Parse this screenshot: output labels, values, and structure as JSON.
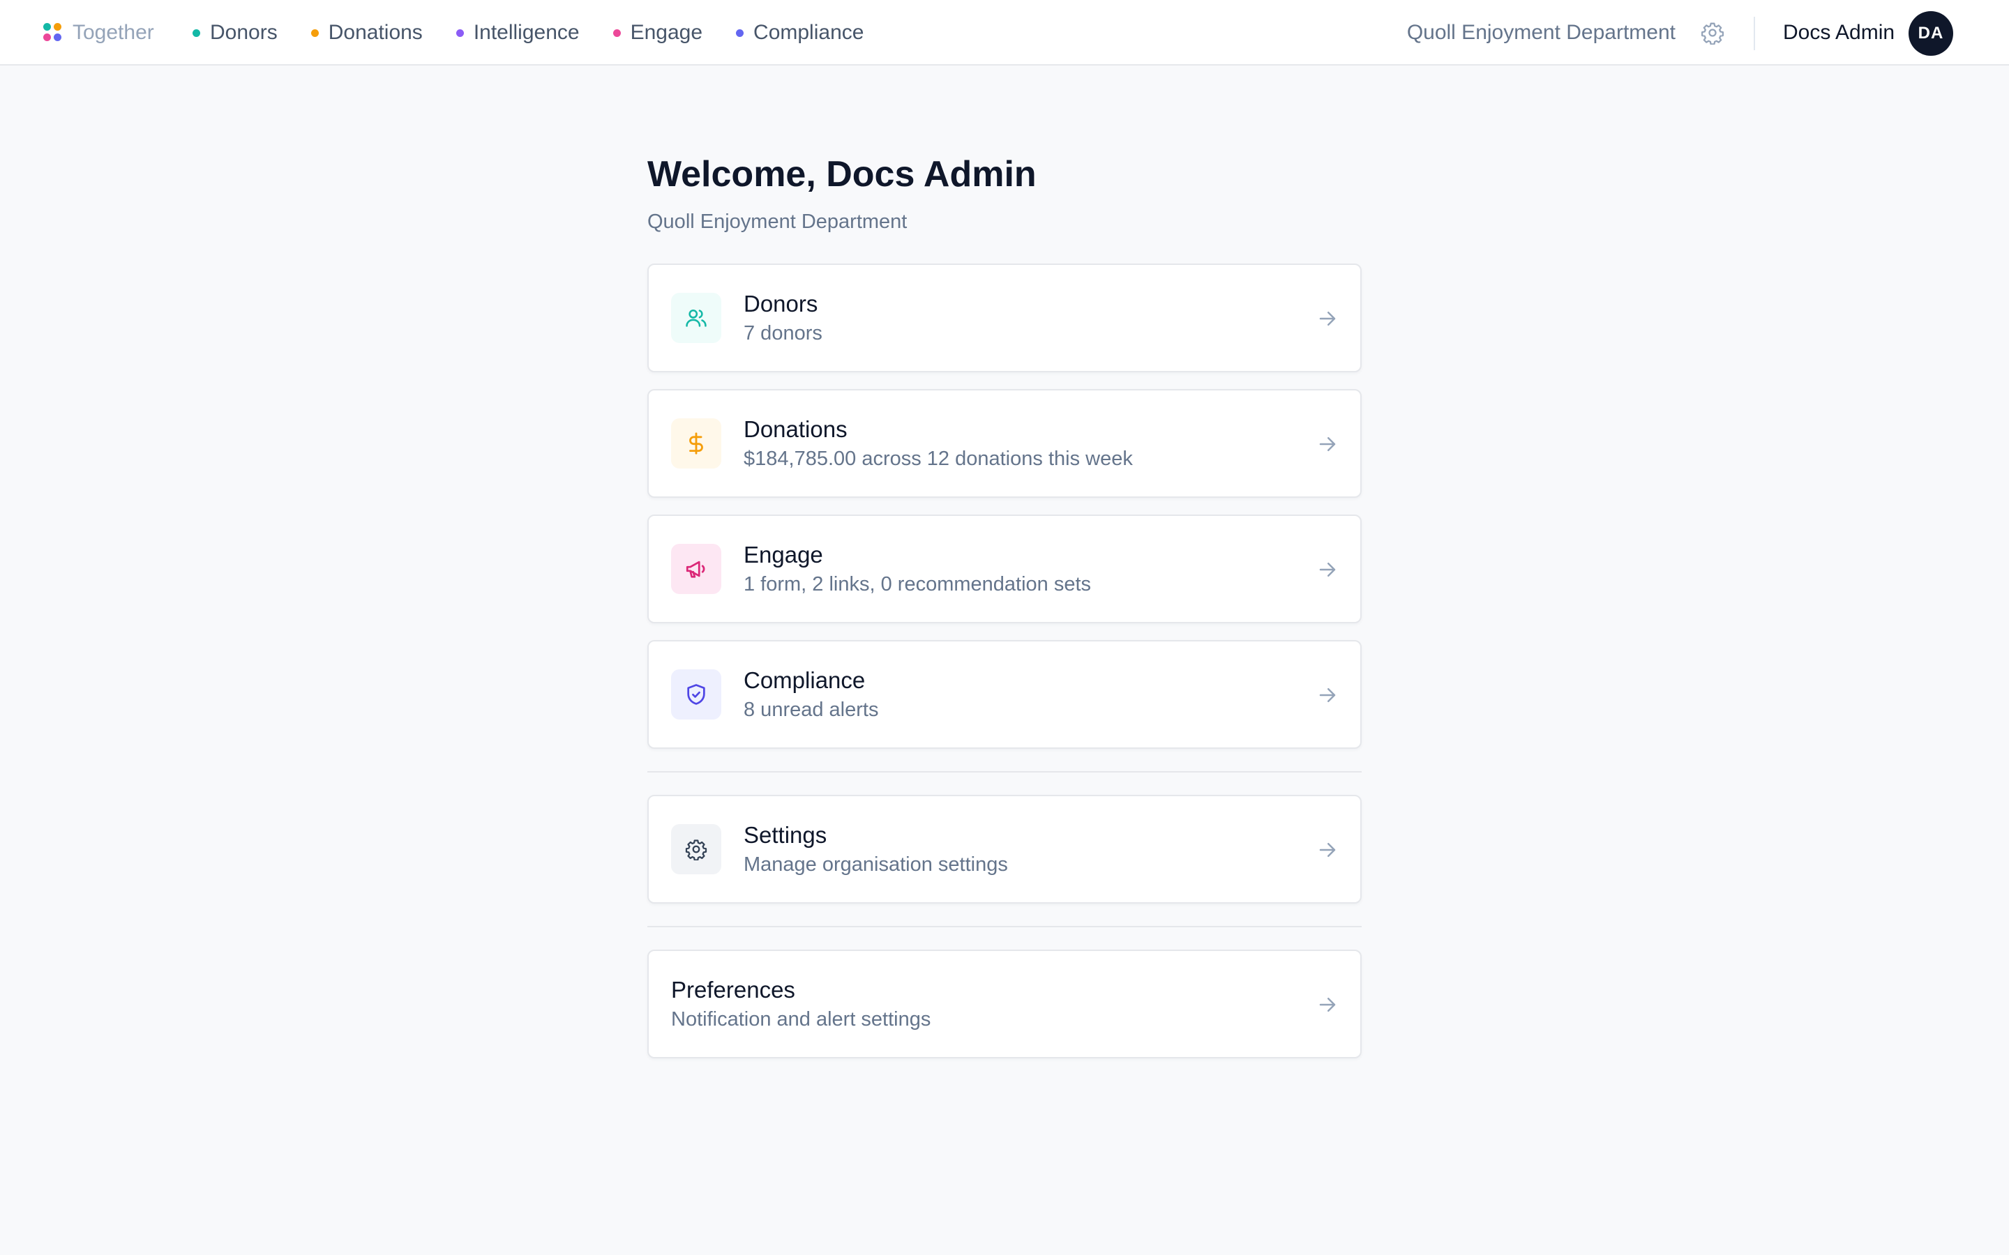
{
  "app": {
    "name": "Together"
  },
  "nav": {
    "items": [
      {
        "label": "Donors",
        "color": "#14b8a6"
      },
      {
        "label": "Donations",
        "color": "#f59e0b"
      },
      {
        "label": "Intelligence",
        "color": "#8b5cf6"
      },
      {
        "label": "Engage",
        "color": "#ec4899"
      },
      {
        "label": "Compliance",
        "color": "#6366f1"
      }
    ]
  },
  "header": {
    "org_name": "Quoll Enjoyment Department",
    "user_name": "Docs Admin",
    "avatar_initials": "DA"
  },
  "main": {
    "welcome": "Welcome, Docs Admin",
    "subtitle": "Quoll Enjoyment Department",
    "cards": [
      {
        "title": "Donors",
        "desc": "7 donors",
        "icon": "users-icon",
        "accent": "#14b8a6",
        "tint": "#effcfa"
      },
      {
        "title": "Donations",
        "desc": "$184,785.00 across 12 donations this week",
        "icon": "dollar-icon",
        "accent": "#f59e0b",
        "tint": "#fff8ea"
      },
      {
        "title": "Engage",
        "desc": "1 form, 2 links, 0 recommendation sets",
        "icon": "megaphone-icon",
        "accent": "#db2777",
        "tint": "#fde7f3"
      },
      {
        "title": "Compliance",
        "desc": "8 unread alerts",
        "icon": "shield-icon",
        "accent": "#4f46e5",
        "tint": "#eef0fe"
      },
      {
        "title": "Settings",
        "desc": "Manage organisation settings",
        "icon": "gear-icon",
        "accent": "#334155",
        "tint": "#f1f3f6"
      },
      {
        "title": "Preferences",
        "desc": "Notification and alert settings"
      }
    ]
  }
}
